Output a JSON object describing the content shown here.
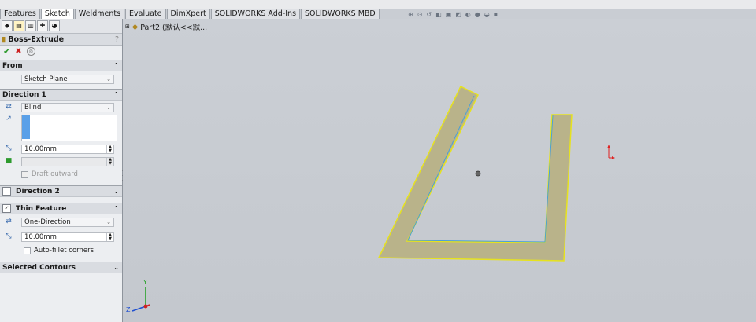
{
  "tabs": [
    {
      "label": "Features",
      "active": false
    },
    {
      "label": "Sketch",
      "active": true
    },
    {
      "label": "Weldments",
      "active": false
    },
    {
      "label": "Evaluate",
      "active": false
    },
    {
      "label": "DimXpert",
      "active": false
    },
    {
      "label": "SOLIDWORKS Add-Ins",
      "active": false
    },
    {
      "label": "SOLIDWORKS MBD",
      "active": false
    }
  ],
  "propertyManager": {
    "title": "Boss-Extrude",
    "help": "?",
    "from": {
      "title": "From",
      "value": "Sketch Plane"
    },
    "direction1": {
      "title": "Direction 1",
      "endCondition": "Blind",
      "depth": "10.00mm",
      "draftOutward": "Draft outward"
    },
    "direction2": {
      "title": "Direction 2"
    },
    "thinFeature": {
      "title": "Thin Feature",
      "type": "One-Direction",
      "thickness": "10.00mm",
      "autoFillet": "Auto-fillet corners"
    },
    "selectedContours": {
      "title": "Selected Contours"
    }
  },
  "tree": {
    "label": "Part2 (默认<<默..."
  },
  "triad": {
    "y": "Y",
    "z": "Z"
  },
  "colors": {
    "shape_fill": "#b9b38a",
    "shape_edge": "#e6e21e",
    "sketch_line": "#4aa0d8"
  }
}
